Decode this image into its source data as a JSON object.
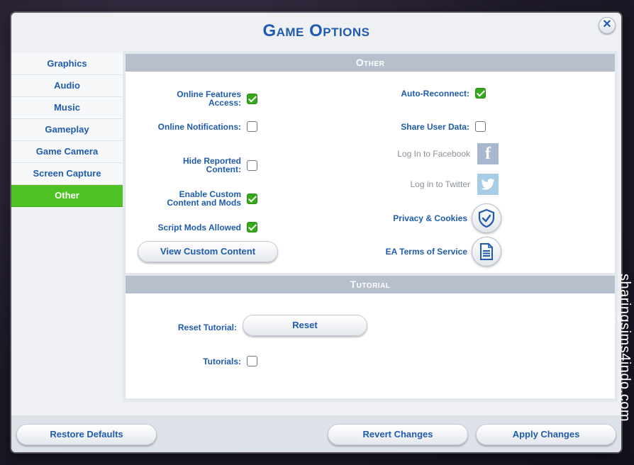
{
  "dialog": {
    "title": "Game Options",
    "close_symbol": "✕"
  },
  "sidebar": {
    "items": [
      {
        "label": "Graphics",
        "active": false
      },
      {
        "label": "Audio",
        "active": false
      },
      {
        "label": "Music",
        "active": false
      },
      {
        "label": "Gameplay",
        "active": false
      },
      {
        "label": "Game Camera",
        "active": false
      },
      {
        "label": "Screen Capture",
        "active": false
      },
      {
        "label": "Other",
        "active": true
      }
    ]
  },
  "other": {
    "header": "Other",
    "online_features_access": {
      "label": "Online Features Access:",
      "checked": true
    },
    "online_notifications": {
      "label": "Online Notifications:",
      "checked": false
    },
    "hide_reported_content": {
      "label": "Hide Reported Content:",
      "checked": false
    },
    "enable_custom_content": {
      "label": "Enable Custom Content and Mods",
      "checked": true
    },
    "script_mods_allowed": {
      "label": "Script Mods Allowed",
      "checked": true
    },
    "view_custom_content_button": "View Custom Content",
    "auto_reconnect": {
      "label": "Auto-Reconnect:",
      "checked": true
    },
    "share_user_data": {
      "label": "Share User Data:",
      "checked": false
    },
    "facebook": {
      "label": "Log In to Facebook",
      "icon": "facebook-icon",
      "glyph": "f"
    },
    "twitter": {
      "label": "Log in to Twitter",
      "icon": "twitter-icon"
    },
    "privacy": {
      "label": "Privacy & Cookies",
      "icon": "shield-check-icon"
    },
    "terms": {
      "label": "EA Terms of Service",
      "icon": "document-icon"
    }
  },
  "tutorial": {
    "header": "Tutorial",
    "reset_label": "Reset Tutorial:",
    "reset_button": "Reset",
    "tutorials": {
      "label": "Tutorials:",
      "checked": false
    }
  },
  "footer": {
    "restore_defaults": "Restore Defaults",
    "revert_changes": "Revert Changes",
    "apply_changes": "Apply Changes"
  },
  "watermark": "sharingsims4indo.com",
  "colors": {
    "accent_blue": "#1f5cad",
    "active_green": "#4ec323",
    "check_green": "#36a81e"
  }
}
